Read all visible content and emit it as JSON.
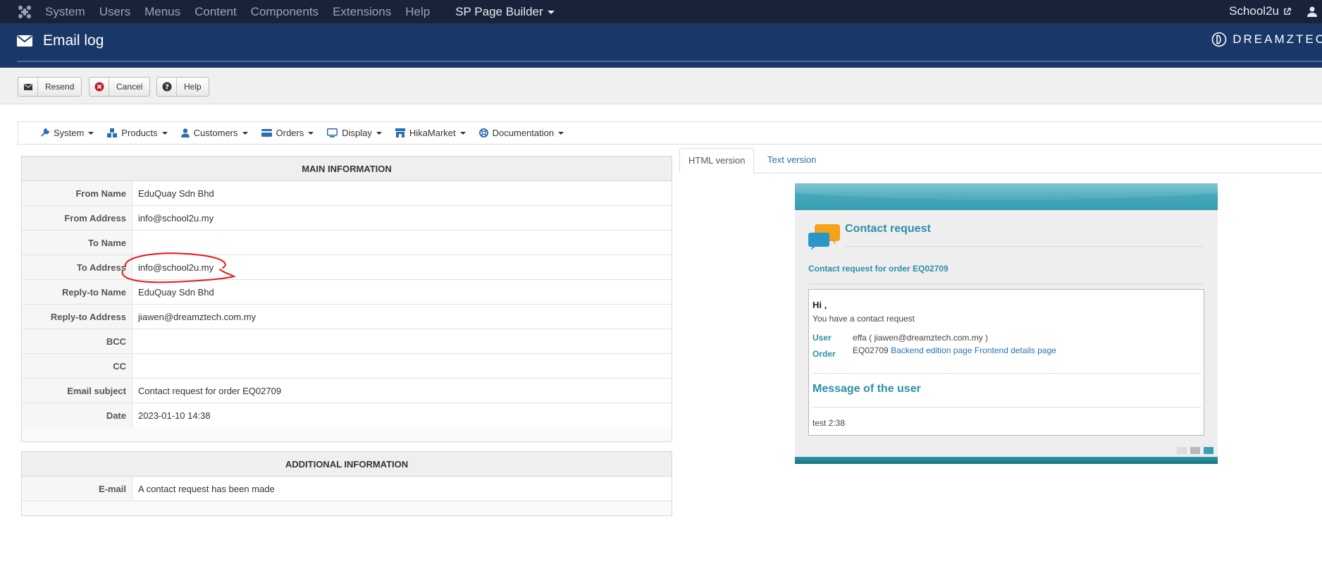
{
  "topnav": {
    "items": [
      "System",
      "Users",
      "Menus",
      "Content",
      "Components",
      "Extensions",
      "Help"
    ],
    "sp_page_builder": "SP Page Builder",
    "site_link": "School2u"
  },
  "header": {
    "title": "Email log",
    "brand": "DREAMZTEC"
  },
  "toolbar": {
    "resend": "Resend",
    "cancel": "Cancel",
    "help": "Help"
  },
  "hikamenu": {
    "items": [
      "System",
      "Products",
      "Customers",
      "Orders",
      "Display",
      "HikaMarket",
      "Documentation"
    ]
  },
  "main_info": {
    "heading": "MAIN INFORMATION",
    "rows": [
      {
        "label": "From Name",
        "value": "EduQuay Sdn Bhd"
      },
      {
        "label": "From Address",
        "value": "info@school2u.my"
      },
      {
        "label": "To Name",
        "value": ""
      },
      {
        "label": "To Address",
        "value": "info@school2u.my"
      },
      {
        "label": "Reply-to Name",
        "value": "EduQuay Sdn Bhd"
      },
      {
        "label": "Reply-to Address",
        "value": "jiawen@dreamztech.com.my"
      },
      {
        "label": "BCC",
        "value": ""
      },
      {
        "label": "CC",
        "value": ""
      },
      {
        "label": "Email subject",
        "value": "Contact request for order EQ02709"
      },
      {
        "label": "Date",
        "value": "2023-01-10 14:38"
      }
    ]
  },
  "additional_info": {
    "heading": "ADDITIONAL INFORMATION",
    "rows": [
      {
        "label": "E-mail",
        "value": "A contact request has been made"
      }
    ]
  },
  "tabs": {
    "html": "HTML version",
    "text": "Text version"
  },
  "email_preview": {
    "heading": "Contact request",
    "subject": "Contact request for order EQ02709",
    "greeting": "Hi ,",
    "intro": "You have a contact request",
    "user_label": "User",
    "user_value": "effa ( jiawen@dreamztech.com.my )",
    "order_label": "Order",
    "order_number": "EQ02709",
    "backend_link": "Backend edition page",
    "frontend_link": "Frontend details page",
    "message_heading": "Message of the user",
    "message": "test 2:38"
  },
  "colors": {
    "topnav_bg": "#18233a",
    "header_bg": "#1a3867",
    "email_accent": "#2c8fa5",
    "annotation": "#e8191a"
  }
}
